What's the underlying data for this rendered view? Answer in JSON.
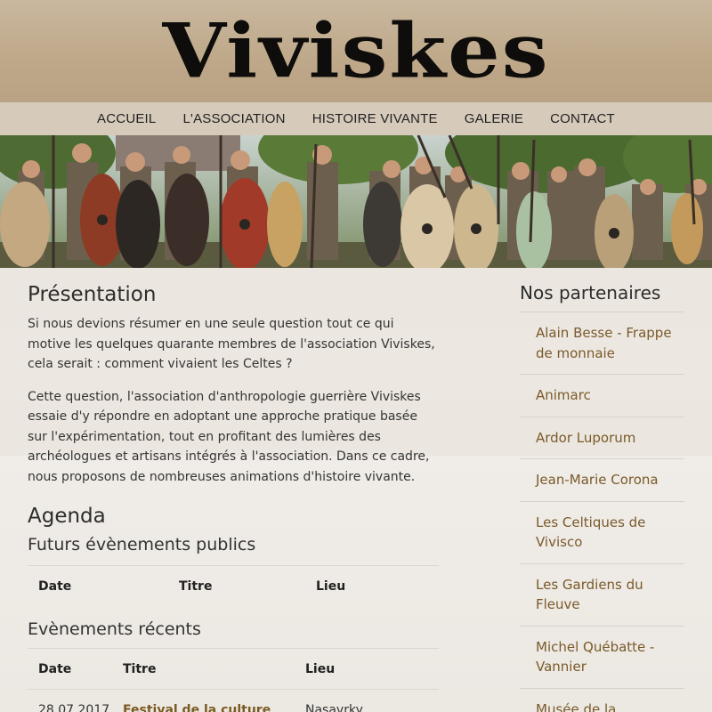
{
  "site": {
    "logo_text": "Viviskes"
  },
  "nav": {
    "items": [
      {
        "label": "ACCUEIL"
      },
      {
        "label": "L'ASSOCIATION"
      },
      {
        "label": "HISTOIRE VIVANTE"
      },
      {
        "label": "GALERIE"
      },
      {
        "label": "CONTACT"
      }
    ]
  },
  "main": {
    "presentation_title": "Présentation",
    "paragraph1": "Si nous devions résumer en une seule question tout ce qui motive les quelques quarante membres de l'association Viviskes, cela serait : comment vivaient les Celtes ?",
    "paragraph2": "Cette question, l'association d'anthropologie guerrière Viviskes essaie d'y répondre en adoptant une approche pratique basée sur l'expérimentation, tout en profitant des lumières des archéologues et artisans intégrés à l'association. Dans ce cadre, nous proposons de nombreuses animations d'histoire vivante.",
    "agenda_title": "Agenda",
    "future_title": "Futurs évènements publics",
    "future_headers": {
      "date": "Date",
      "titre": "Titre",
      "lieu": "Lieu"
    },
    "recent_title": "Evènements récents",
    "recent_headers": {
      "date": "Date",
      "titre": "Titre",
      "lieu": "Lieu"
    },
    "recent_rows": [
      {
        "date": "28.07.2017",
        "titre": "Festival de la culture",
        "lieu": "Nasavrky"
      }
    ]
  },
  "sidebar": {
    "title": "Nos partenaires",
    "partners": [
      "Alain Besse - Frappe de monnaie",
      "Animarc",
      "Ardor Luporum",
      "Jean-Marie Corona",
      "Les Celtiques de Viviscо",
      "Les Gardiens du Fleuve",
      "Michel Québatte - Vannier",
      "Musée de la"
    ]
  },
  "colors": {
    "accent": "#7a5a2a",
    "nav_bg": "#d6cabb",
    "header_bg": "#c2ae92"
  }
}
